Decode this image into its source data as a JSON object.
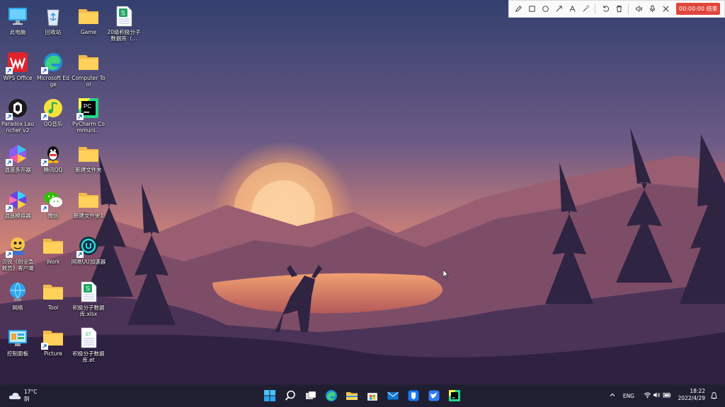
{
  "desktop_icons": [
    {
      "label": "此电脑",
      "icon": "computer-icon"
    },
    {
      "label": "回收站",
      "icon": "recycle-bin-icon"
    },
    {
      "label": "Game",
      "icon": "folder-icon"
    },
    {
      "label": "20级积极分子数据库（...",
      "icon": "spreadsheet-file-icon"
    },
    {
      "label": "WPS Office",
      "icon": "wps-office-icon"
    },
    {
      "label": "Microsoft Edge",
      "icon": "edge-icon"
    },
    {
      "label": "Computer Tool",
      "icon": "folder-icon"
    },
    {
      "label": "Paradox Launcher v2",
      "icon": "paradox-launcher-icon"
    },
    {
      "label": "QQ音乐",
      "icon": "qq-music-icon"
    },
    {
      "label": "PyCharm Communi...",
      "icon": "pycharm-icon"
    },
    {
      "label": "逍遥多开器",
      "icon": "xiaoyao-multi-icon"
    },
    {
      "label": "腾讯QQ",
      "icon": "qq-icon"
    },
    {
      "label": "新建文件夹",
      "icon": "folder-icon"
    },
    {
      "label": "逍遥模拟器",
      "icon": "xiaoyao-emulator-icon"
    },
    {
      "label": "微信",
      "icon": "wechat-icon"
    },
    {
      "label": "新建文件夹1",
      "icon": "folder-icon"
    },
    {
      "label": "贝锐《创业急救员》客户端",
      "icon": "game-client-icon"
    },
    {
      "label": "Work",
      "icon": "folder-icon"
    },
    {
      "label": "网易UU加速器",
      "icon": "uu-accelerator-icon"
    },
    {
      "label": "网络",
      "icon": "network-icon"
    },
    {
      "label": "Tool",
      "icon": "folder-icon"
    },
    {
      "label": "积极分子数据库.xlsx",
      "icon": "spreadsheet-file-icon"
    },
    {
      "label": "控制面板",
      "icon": "control-panel-icon"
    },
    {
      "label": "Picture",
      "icon": "folder-icon"
    },
    {
      "label": "积极分子数据库.et",
      "icon": "et-file-icon"
    }
  ],
  "recorder_toolbar": {
    "tools": [
      "pen-icon",
      "rectangle-icon",
      "ellipse-icon",
      "arrow-icon",
      "text-icon",
      "magic-icon",
      "undo-icon",
      "trash-icon",
      "speaker-icon",
      "microphone-icon",
      "close-icon"
    ],
    "timer_text": "00:00:00 结束",
    "timer_color": "#e0463c"
  },
  "weather": {
    "temperature": "17°C",
    "condition": "阴"
  },
  "taskbar": {
    "apps": [
      "windows-start-icon",
      "search-icon",
      "task-view-icon",
      "edge-icon",
      "file-explorer-icon",
      "microsoft-store-icon",
      "mail-icon",
      "app-blue-shield-icon",
      "app-bird-icon",
      "app-pycharm-icon"
    ]
  },
  "tray": {
    "language": "ENG",
    "time": "18:22",
    "date": "2022/4/29",
    "icons": [
      "chevron-up-icon",
      "wifi-icon",
      "volume-icon",
      "battery-icon",
      "notification-icon"
    ]
  }
}
